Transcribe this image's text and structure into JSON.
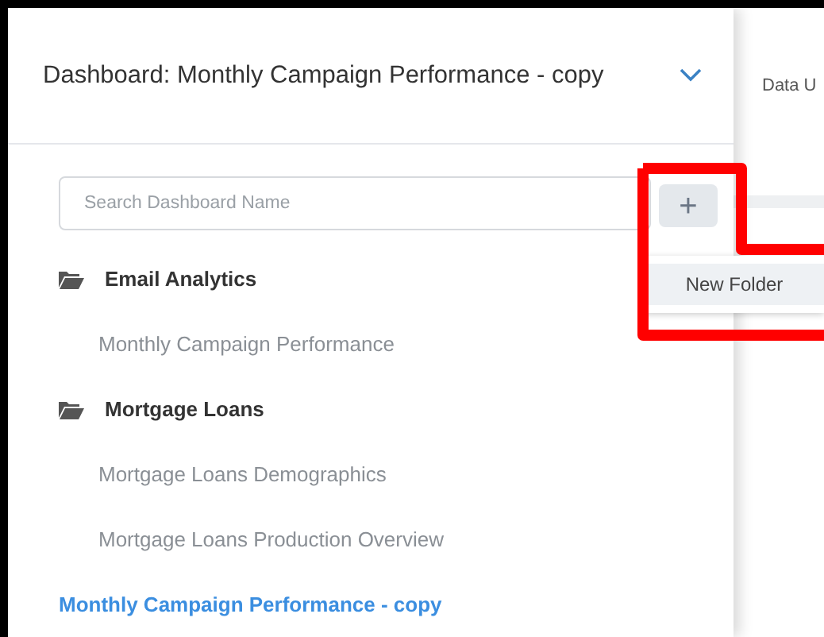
{
  "header": {
    "title": "Dashboard: Monthly Campaign Performance - copy"
  },
  "right_panel": {
    "label": "Data U"
  },
  "search": {
    "placeholder": "Search Dashboard Name"
  },
  "add_menu": {
    "button": "+",
    "items": [
      {
        "label": "New Folder"
      }
    ]
  },
  "tree": [
    {
      "kind": "folder",
      "label": "Email Analytics",
      "expanded": true,
      "children": [
        {
          "kind": "dashboard",
          "label": "Monthly Campaign Performance",
          "selected": false
        }
      ]
    },
    {
      "kind": "folder",
      "label": "Mortgage Loans",
      "expanded": true,
      "children": [
        {
          "kind": "dashboard",
          "label": "Mortgage Loans Demographics",
          "selected": false
        },
        {
          "kind": "dashboard",
          "label": "Mortgage Loans Production Overview",
          "selected": false
        }
      ]
    },
    {
      "kind": "dashboard",
      "label": "Monthly Campaign Performance - copy",
      "selected": true
    }
  ]
}
